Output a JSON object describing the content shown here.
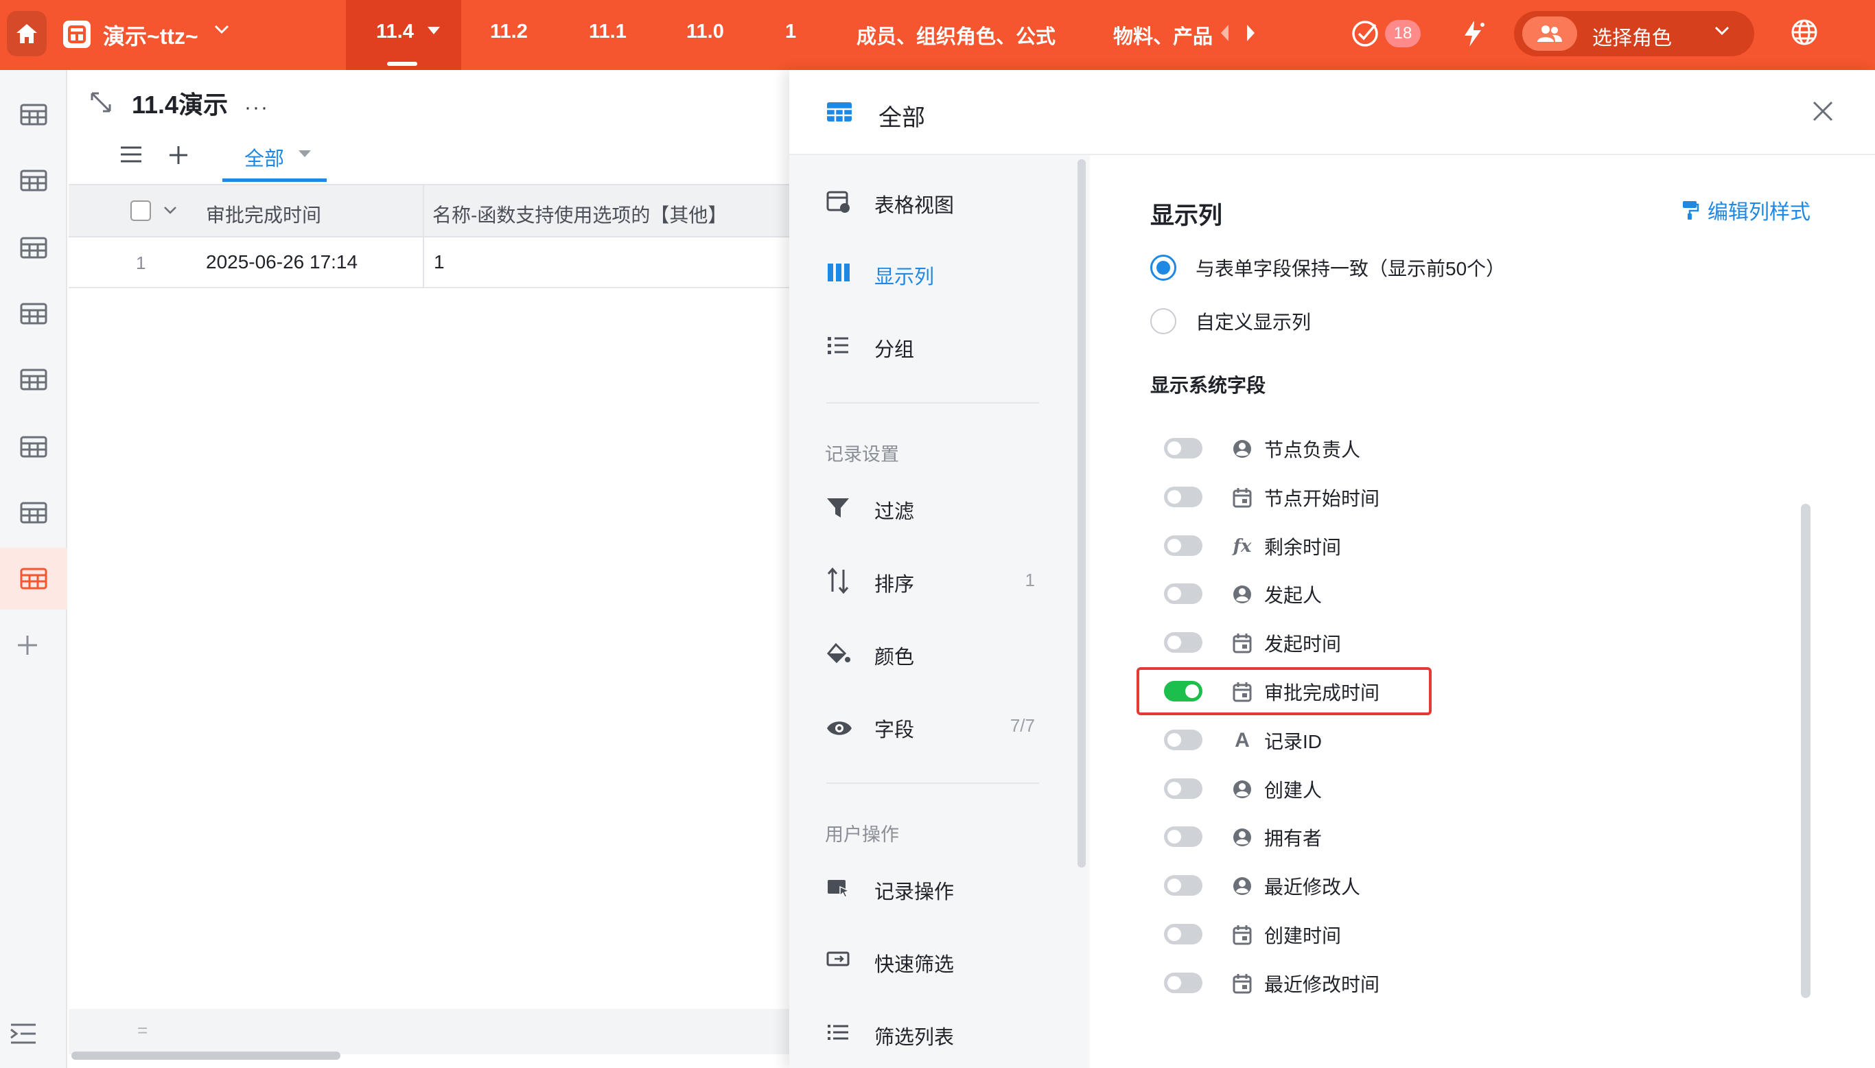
{
  "topbar": {
    "app_title": "演示~ttz~",
    "tabs": [
      "11.4",
      "11.2",
      "11.1",
      "11.0",
      "1",
      "成员、组织角色、公式",
      "物料、产品"
    ],
    "todo_count": "18",
    "role_label": "选择角色"
  },
  "page": {
    "title": "11.4演示",
    "more": "···",
    "view_tab": "全部"
  },
  "table": {
    "headers": [
      "审批完成时间",
      "名称-函数支持使用选项的【其他】"
    ],
    "rows": [
      {
        "num": "1",
        "cells": [
          "2025-06-26 17:14",
          "1"
        ]
      }
    ],
    "footer_mark": "="
  },
  "panel": {
    "title": "全部",
    "nav": [
      {
        "label": "表格视图",
        "icon": "table-view-icon"
      },
      {
        "label": "显示列",
        "icon": "columns-icon",
        "active": true
      },
      {
        "label": "分组",
        "icon": "group-icon"
      }
    ],
    "section_record": "记录设置",
    "nav_record": [
      {
        "label": "过滤",
        "icon": "filter-icon",
        "count": ""
      },
      {
        "label": "排序",
        "icon": "sort-icon",
        "count": "1"
      },
      {
        "label": "颜色",
        "icon": "paint-bucket-icon",
        "count": ""
      },
      {
        "label": "字段",
        "icon": "eye-icon",
        "count": "7/7"
      }
    ],
    "section_user": "用户操作",
    "nav_user": [
      {
        "label": "记录操作",
        "icon": "record-action-icon"
      },
      {
        "label": "快速筛选",
        "icon": "quick-filter-icon"
      },
      {
        "label": "筛选列表",
        "icon": "filter-list-icon"
      }
    ],
    "content": {
      "title": "显示列",
      "edit_style": "编辑列样式",
      "radio_consistent": "与表单字段保持一致（显示前50个）",
      "radio_custom": "自定义显示列",
      "selected_option": "与表单字段保持一致（显示前50个）",
      "sys_fields_title": "显示系统字段",
      "fields": [
        {
          "label": "节点负责人",
          "icon": "user-icon",
          "on": false
        },
        {
          "label": "节点开始时间",
          "icon": "calendar-icon",
          "on": false
        },
        {
          "label": "剩余时间",
          "icon": "formula-icon",
          "on": false
        },
        {
          "label": "发起人",
          "icon": "user-icon",
          "on": false
        },
        {
          "label": "发起时间",
          "icon": "calendar-icon",
          "on": false
        },
        {
          "label": "审批完成时间",
          "icon": "calendar-icon",
          "on": true
        },
        {
          "label": "记录ID",
          "icon": "text-icon",
          "on": false
        },
        {
          "label": "创建人",
          "icon": "user-icon",
          "on": false
        },
        {
          "label": "拥有者",
          "icon": "user-icon",
          "on": false
        },
        {
          "label": "最近修改人",
          "icon": "user-icon",
          "on": false
        },
        {
          "label": "创建时间",
          "icon": "calendar-icon",
          "on": false
        },
        {
          "label": "最近修改时间",
          "icon": "calendar-icon",
          "on": false
        }
      ]
    }
  },
  "colors": {
    "brand": "#f5552f",
    "accent": "#1e88e5",
    "toggle_on": "#1cbf4c",
    "highlight": "#e53935"
  }
}
